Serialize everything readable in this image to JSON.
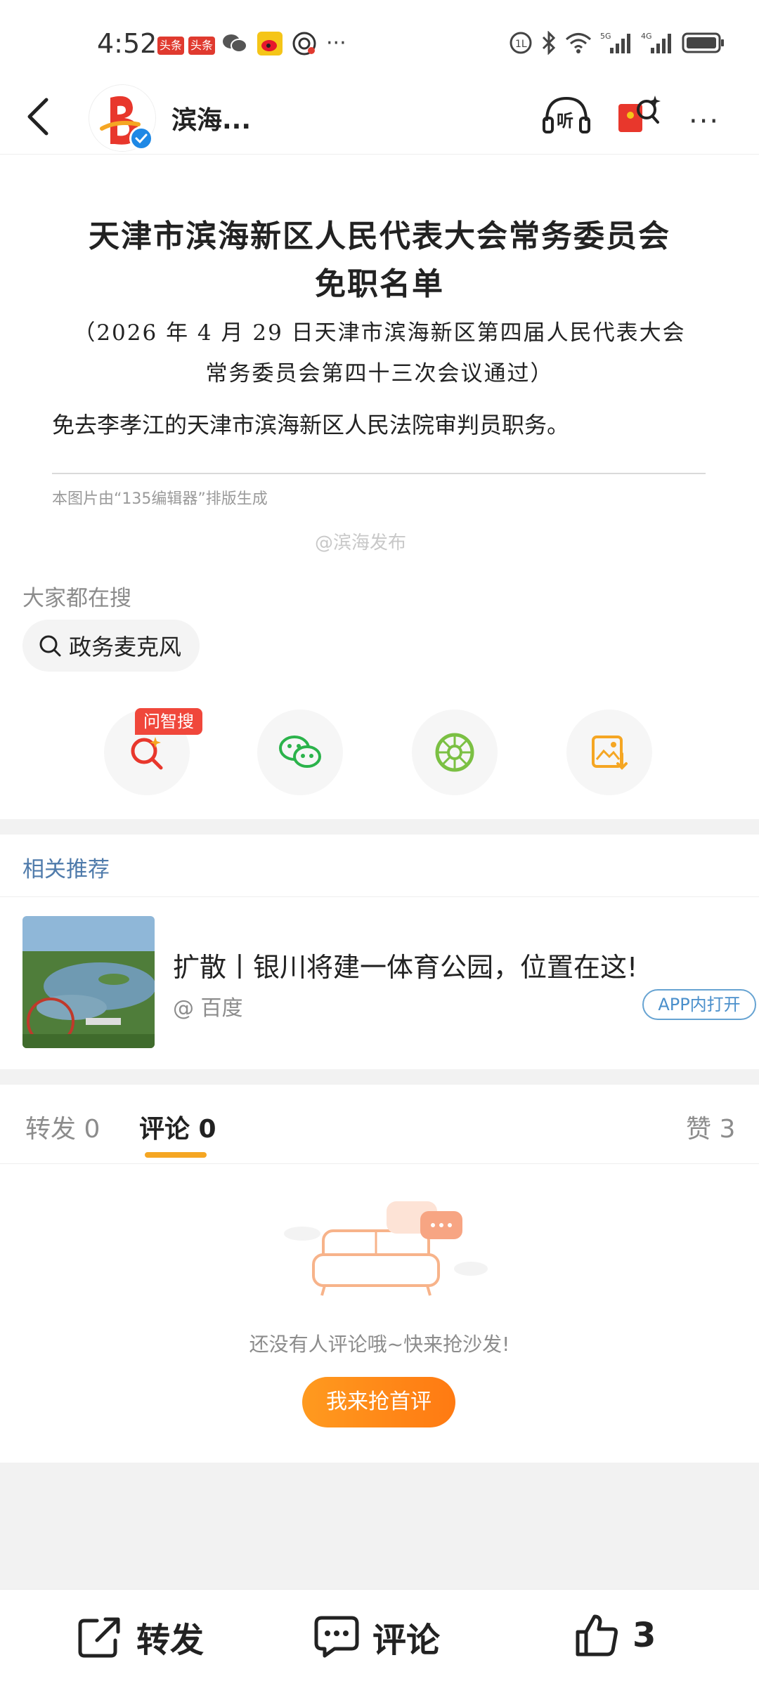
{
  "status_bar": {
    "time": "4:52",
    "badge_1": "头条",
    "badge_2": "头条",
    "more": "···"
  },
  "nav": {
    "account_name": "滨海...",
    "listen_label": "听"
  },
  "article": {
    "doc_title_line1": "天津市滨海新区人民代表大会常务委员会",
    "doc_title_line2": "免职名单",
    "doc_sub_line1": "（2026 年 4 月 29 日天津市滨海新区第四届人民代表大会",
    "doc_sub_line2": "常务委员会第四十三次会议通过）",
    "doc_body": "免去李孝江的天津市滨海新区人民法院审判员职务。",
    "doc_credit": "本图片由“135编辑器”排版生成",
    "watermark": "@滨海发布"
  },
  "hot_search": {
    "label": "大家都在搜",
    "chip": "政务麦克风"
  },
  "share": {
    "zhisou_tag": "问智搜",
    "items": [
      "zhisou",
      "wechat",
      "moments",
      "save-image"
    ]
  },
  "related": {
    "label": "相关推荐",
    "title": "扩散丨银川将建一体育公园，位置在这!",
    "source": "@ 百度",
    "app_button": "APP内打开"
  },
  "tabs": {
    "repost": "转发 0",
    "comment": "评论 0",
    "like": "赞 3"
  },
  "comments_empty": {
    "message": "还没有人评论哦~快来抢沙发!",
    "button": "我来抢首评"
  },
  "bottom_bar": {
    "repost": "转发",
    "comment": "评论",
    "like_count": "3"
  },
  "colors": {
    "accent_orange": "#ff8a1a",
    "tab_underline": "#f5a623",
    "link_blue": "#4f7bab",
    "badge_red": "#e03a2f"
  }
}
